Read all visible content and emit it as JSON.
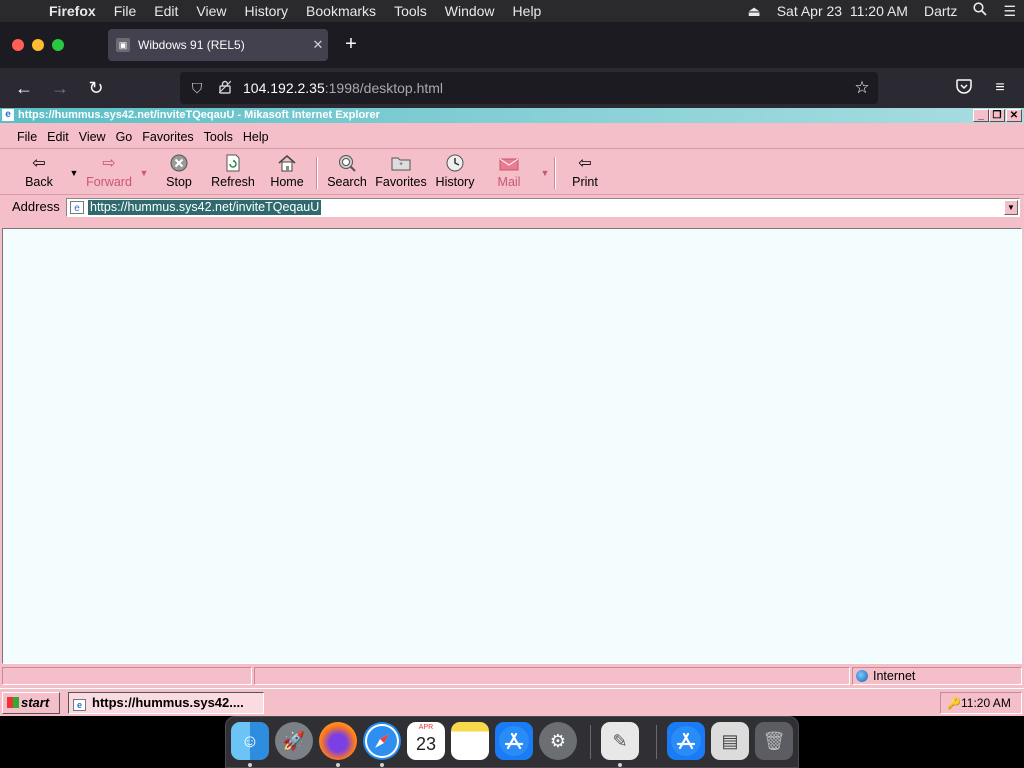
{
  "menubar": {
    "app": "Firefox",
    "items": [
      "File",
      "Edit",
      "View",
      "History",
      "Bookmarks",
      "Tools",
      "Window",
      "Help"
    ],
    "datetime": "Sat Apr 23  11:20 AM",
    "user": "Dartz"
  },
  "firefox": {
    "tab_title": "Wibdows 91 (REL5)",
    "url_host": "104.192.2.35",
    "url_rest": ":1998/desktop.html"
  },
  "ie": {
    "title": "https://hummus.sys42.net/inviteTQeqauU - Mikasoft Internet Explorer",
    "menu": [
      "File",
      "Edit",
      "View",
      "Go",
      "Favorites",
      "Tools",
      "Help"
    ],
    "toolbar": {
      "back": "Back",
      "forward": "Forward",
      "stop": "Stop",
      "refresh": "Refresh",
      "home": "Home",
      "search": "Search",
      "favorites": "Favorites",
      "history": "History",
      "mail": "Mail",
      "print": "Print"
    },
    "address_label": "Address",
    "address_value": "https://hummus.sys42.net/inviteTQeqauU",
    "status_zone": "Internet",
    "start_label": "start",
    "task_label": "https://hummus.sys42....",
    "tray_time": "11:20 AM"
  },
  "dock": {
    "calendar_month": "APR",
    "calendar_day": "23"
  },
  "colors": {
    "ie_chrome": "#f4bfc8",
    "ie_title_gradient": "#5bbfc6",
    "ie_content": "#f3fdfd",
    "address_highlight": "#2f6b6e",
    "firefox_dark": "#1c1b22"
  }
}
